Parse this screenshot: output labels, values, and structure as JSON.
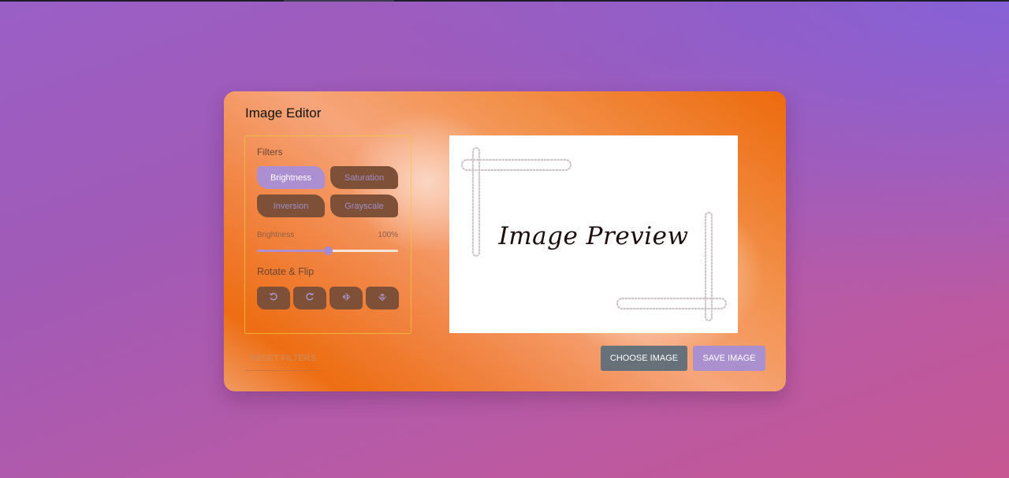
{
  "app": {
    "title": "Image Editor"
  },
  "filters": {
    "heading": "Filters",
    "buttons": [
      {
        "label": "Brightness",
        "active": true
      },
      {
        "label": "Saturation",
        "active": false
      },
      {
        "label": "Inversion",
        "active": false
      },
      {
        "label": "Grayscale",
        "active": false
      }
    ],
    "slider": {
      "name": "Brightness",
      "value_text": "100%",
      "level_fraction": 0.5
    }
  },
  "rotate": {
    "heading": "Rotate & Flip",
    "buttons": [
      {
        "icon": "rotate-left-icon"
      },
      {
        "icon": "rotate-right-icon"
      },
      {
        "icon": "flip-horizontal-icon"
      },
      {
        "icon": "flip-vertical-icon"
      }
    ]
  },
  "preview": {
    "text": "Image Preview"
  },
  "controls": {
    "reset_label": "RESET FILTERS",
    "choose_label": "CHOOSE IMAGE",
    "save_label": "SAVE IMAGE"
  },
  "colors": {
    "accent": "#ab8fd1",
    "button_dark": "#7f5038",
    "choose_button": "#66717a"
  }
}
